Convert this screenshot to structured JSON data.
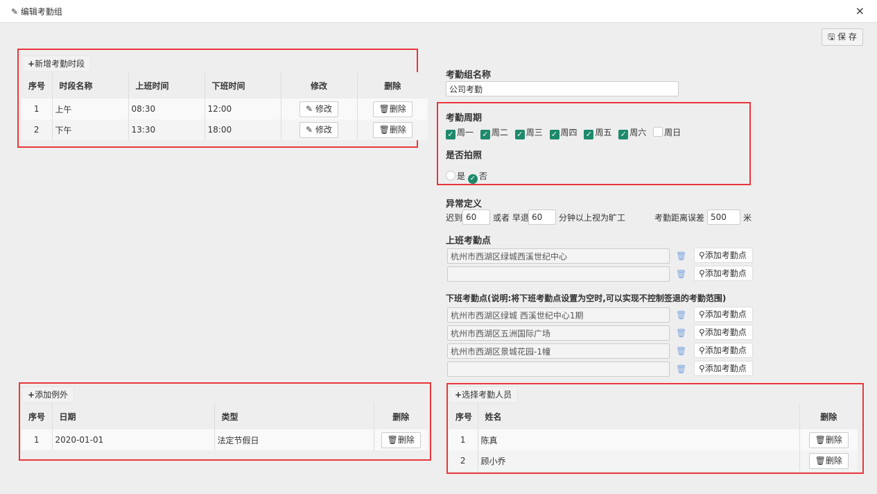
{
  "window": {
    "title": "编辑考勤组",
    "close_icon": "×"
  },
  "toolbar": {
    "save_label": "保 存"
  },
  "periods": {
    "add_label": "新增考勤时段",
    "headers": [
      "序号",
      "时段名称",
      "上班时间",
      "下班时间",
      "修改",
      "删除"
    ],
    "rows": [
      {
        "no": "1",
        "name": "上午",
        "start": "08:30",
        "end": "12:00"
      },
      {
        "no": "2",
        "name": "下午",
        "start": "13:30",
        "end": "18:00"
      }
    ],
    "edit_label": "修改",
    "delete_label": "删除"
  },
  "group": {
    "name_label": "考勤组名称",
    "name_value": "公司考勤"
  },
  "cycle": {
    "label": "考勤周期",
    "days": [
      {
        "label": "周一",
        "checked": true
      },
      {
        "label": "周二",
        "checked": true
      },
      {
        "label": "周三",
        "checked": true
      },
      {
        "label": "周四",
        "checked": true
      },
      {
        "label": "周五",
        "checked": true
      },
      {
        "label": "周六",
        "checked": true
      },
      {
        "label": "周日",
        "checked": false
      }
    ]
  },
  "photo": {
    "label": "是否拍照",
    "yes": "是",
    "no": "否",
    "selected": "否"
  },
  "abnormal": {
    "label": "异常定义",
    "late_prefix": "迟到",
    "late_value": "60",
    "or_early": "或者 早退",
    "early_value": "60",
    "suffix": "分钟以上视为旷工",
    "distance_label": "考勤距离误差",
    "distance_value": "500",
    "distance_unit": "米"
  },
  "checkin_points": {
    "label": "上班考勤点",
    "items": [
      "杭州市西湖区绿城西溪世纪中心",
      ""
    ],
    "add_label": "添加考勤点"
  },
  "checkout_points": {
    "label": "下班考勤点(说明:将下班考勤点设置为空时,可以实现不控制签退的考勤范围)",
    "items": [
      "杭州市西湖区绿城 西溪世纪中心1期",
      "杭州市西湖区五洲国际广场",
      "杭州市西湖区景城花园-1幢",
      ""
    ],
    "add_label": "添加考勤点"
  },
  "exceptions": {
    "add_label": "添加例外",
    "headers": [
      "序号",
      "日期",
      "类型",
      "删除"
    ],
    "rows": [
      {
        "no": "1",
        "date": "2020-01-01",
        "type": "法定节假日"
      }
    ],
    "delete_label": "删除"
  },
  "staff": {
    "add_label": "选择考勤人员",
    "headers": [
      "序号",
      "姓名",
      "删除"
    ],
    "rows": [
      {
        "no": "1",
        "name": "陈真"
      },
      {
        "no": "2",
        "name": "顾小乔"
      }
    ],
    "delete_label": "删除"
  },
  "colors": {
    "accent": "#1e8a6b",
    "highlight": "#e8363a",
    "trash": "#7ea6e0"
  }
}
